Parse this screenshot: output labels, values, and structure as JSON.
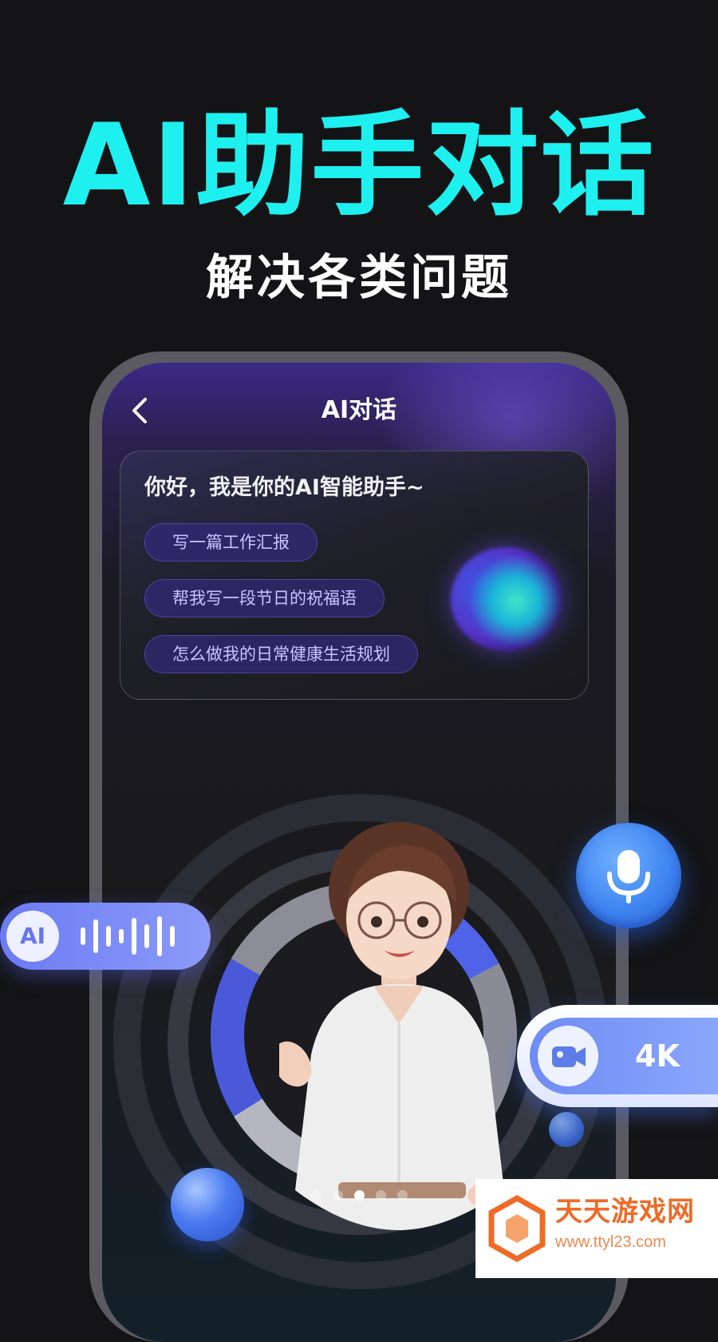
{
  "promo": {
    "headline": "AI助手对话",
    "subheadline": "解决各类问题"
  },
  "header": {
    "title": "AI对话",
    "back_icon": "chevron-left-icon"
  },
  "chat": {
    "greeting": "你好，我是你的AI智能助手~",
    "suggestions": [
      "写一篇工作汇报",
      "帮我写一段节日的祝福语",
      "怎么做我的日常健康生活规划"
    ]
  },
  "badges": {
    "voice_label": "AI",
    "video_label": "4K"
  },
  "pager": {
    "count": 5,
    "active_index": 2
  },
  "watermark": {
    "name": "天天游戏网",
    "url": "www.ttyl23.com"
  },
  "colors": {
    "accent_cyan": "#1ef0f0",
    "accent_blue": "#4f63e8",
    "watermark_orange": "#ee6a27"
  }
}
